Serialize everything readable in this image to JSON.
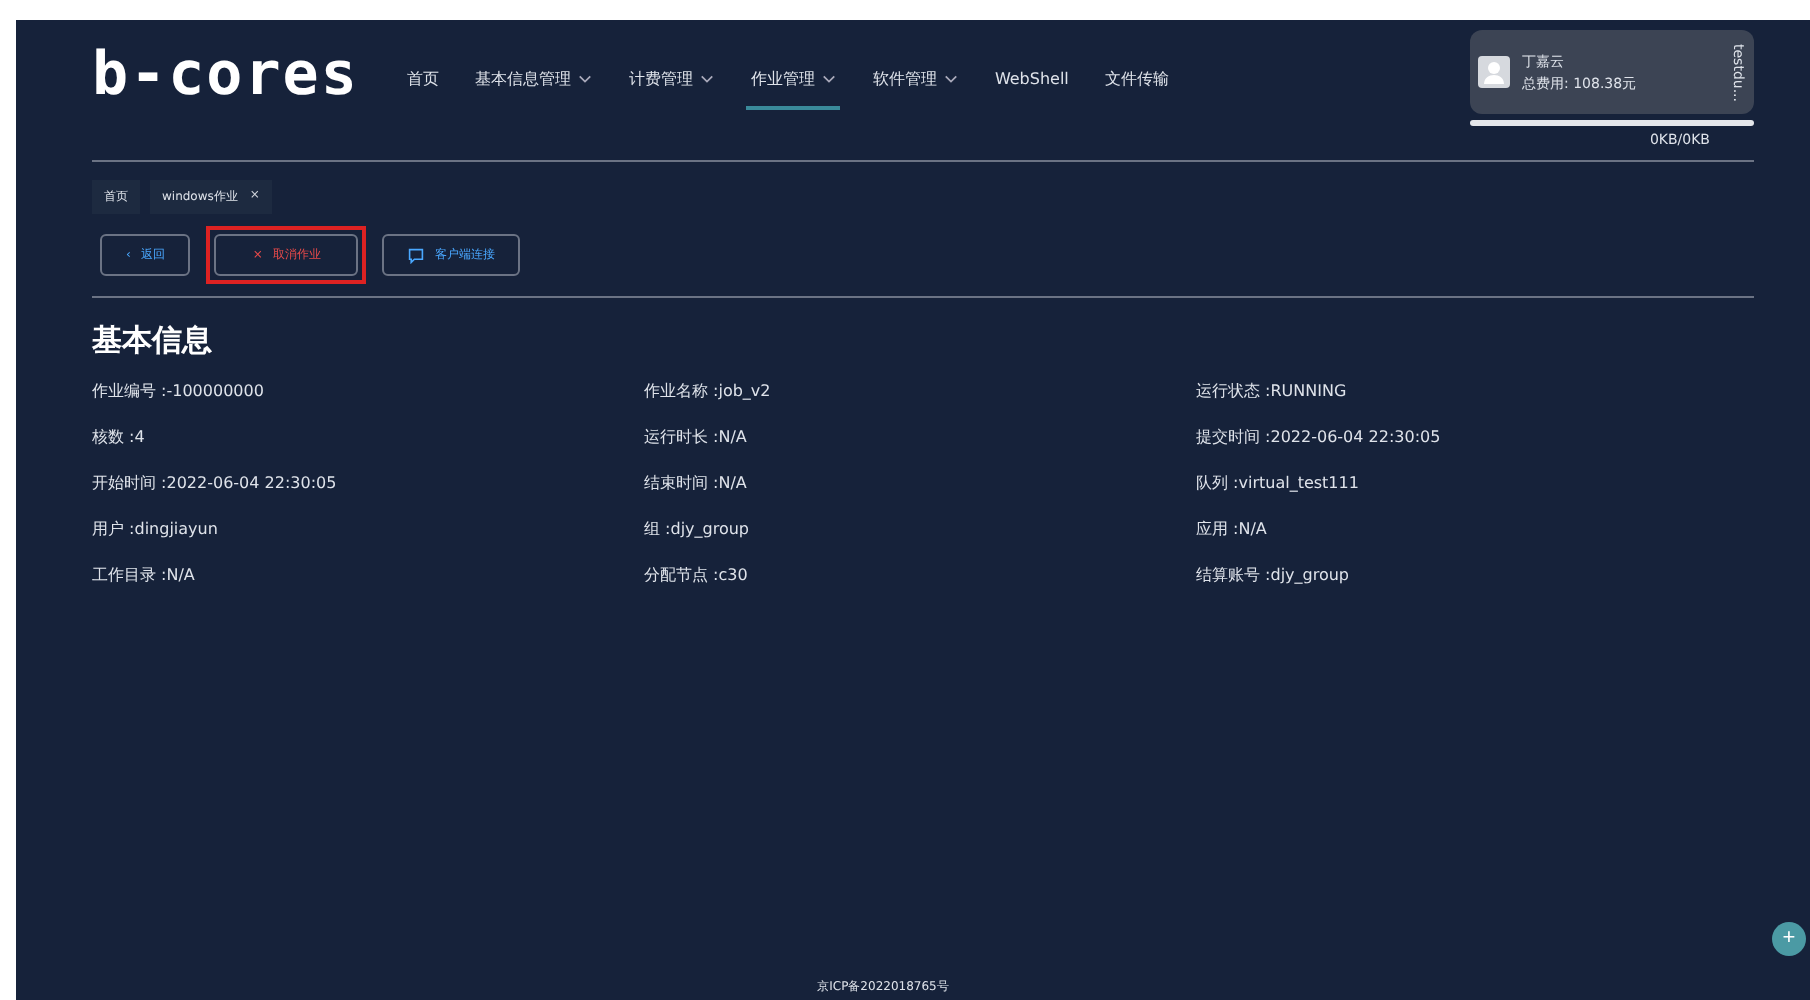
{
  "logo": "b-cores",
  "nav": [
    {
      "label": "首页",
      "dropdown": false,
      "selected": false
    },
    {
      "label": "基本信息管理",
      "dropdown": true,
      "selected": false
    },
    {
      "label": "计费管理",
      "dropdown": true,
      "selected": false
    },
    {
      "label": "作业管理",
      "dropdown": true,
      "selected": true
    },
    {
      "label": "软件管理",
      "dropdown": true,
      "selected": false
    },
    {
      "label": "WebShell",
      "dropdown": false,
      "selected": false
    },
    {
      "label": "文件传输",
      "dropdown": false,
      "selected": false
    }
  ],
  "user": {
    "name": "丁嘉云",
    "cost": "总费用: 108.38元",
    "account": "testdu...",
    "storage": "0KB/0KB"
  },
  "breadcrumb_tabs": [
    {
      "label": "首页",
      "closable": false
    },
    {
      "label": "windows作业",
      "closable": true,
      "close": "×"
    }
  ],
  "actions": [
    {
      "label": "返回",
      "icon": "‹",
      "kind": "back",
      "highlighted": false
    },
    {
      "label": "取消作业",
      "icon": "×",
      "kind": "danger",
      "highlighted": true
    },
    {
      "label": "客户端连接",
      "kind": "connect",
      "highlighted": false
    }
  ],
  "section_title": "基本信息",
  "fields": [
    {
      "text": "作业编号 :-100000000"
    },
    {
      "text": "作业名称 :job_v2"
    },
    {
      "text": "运行状态 :RUNNING"
    },
    {
      "text": "核数 :4"
    },
    {
      "text": "运行时长 :N/A"
    },
    {
      "text": "提交时间 :2022-06-04 22:30:05"
    },
    {
      "text": "开始时间 :2022-06-04 22:30:05"
    },
    {
      "text": "结束时间 :N/A"
    },
    {
      "text": "队列 :virtual_test111"
    },
    {
      "text": "用户 :dingjiayun"
    },
    {
      "text": "组 :djy_group"
    },
    {
      "text": "应用 :N/A"
    },
    {
      "text": "工作目录 :N/A"
    },
    {
      "text": "分配节点 :c30"
    },
    {
      "text": "结算账号 :djy_group"
    }
  ],
  "footer": "京ICP备2022018765号",
  "fab": "+"
}
